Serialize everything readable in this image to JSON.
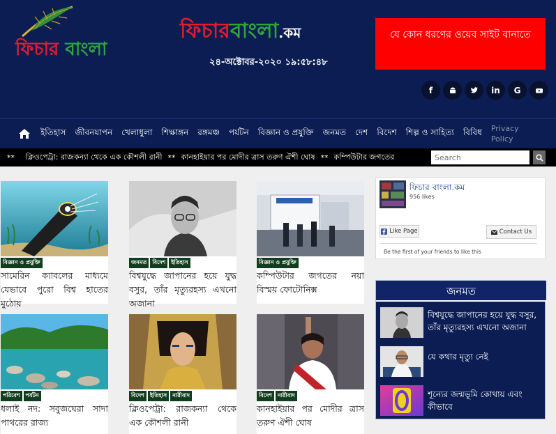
{
  "site": {
    "logo_left": {
      "part1": "ফিচার ",
      "part2": "বাংলা"
    },
    "logo_center": {
      "part1": "ফিচার",
      "part2": "বাংলা",
      "part3": ".কম"
    },
    "datetime": "২৪-অক্টোবর-২০২০ ১৯:৫৮:৪৮",
    "ad_text": "যে কোন ধরণের ওয়েব সাইট বানাতে"
  },
  "social": [
    {
      "icon": "facebook-icon",
      "glyph": "f"
    },
    {
      "icon": "android-icon",
      "glyph": ""
    },
    {
      "icon": "twitter-icon",
      "glyph": ""
    },
    {
      "icon": "linkedin-icon",
      "glyph": "in"
    },
    {
      "icon": "google-icon",
      "glyph": "G"
    },
    {
      "icon": "youtube-icon",
      "glyph": ""
    }
  ],
  "nav": {
    "items": [
      "ইতিহাস",
      "জীবনযাপন",
      "খেলাধুলা",
      "শিক্ষাঙ্গন",
      "রঙ্গমঞ্চ",
      "পর্যটন",
      "বিজ্ঞান ও প্রযুক্তি",
      "জনমত",
      "দেশ",
      "বিদেশ",
      "শিল্প ও সাহিত্য",
      "বিবিধ"
    ],
    "privacy": "Privacy Policy"
  },
  "ticker": {
    "items": [
      "ক্লিওপেট্রা: রাজকন্যা থেকে এক কৌশলী রানী",
      "কানহাইয়ার পর মোদীর ত্রাস তরুণ ঐশী ঘোষ",
      "কম্পিউটার জগতের"
    ],
    "separator": "**"
  },
  "search": {
    "placeholder": "Search"
  },
  "articles": [
    {
      "tags": [
        "বিজ্ঞান ও প্রযুক্তি"
      ],
      "title": "সামেরিন ক্যাবলের মাধ্যমে যেভাবে পুরো বিশ্ব হাতের মুঠোয়"
    },
    {
      "tags": [
        "জনমত",
        "বিদেশ",
        "ইতিহাস"
      ],
      "title": "বিশ্বযুদ্ধে জাপানের হয়ে যুদ্ধ বসুর, তাঁর মৃত্যুরহস্য এখনো অজানা"
    },
    {
      "tags": [
        "বিজ্ঞান ও প্রযুক্তি"
      ],
      "title": "কম্পিউটার জগতের নয়া বিস্ময় ফোটোনিক্স"
    },
    {
      "tags": [
        "পরিবেশ",
        "পর্যটন"
      ],
      "title": "ধলাই নদ: সবুজঘেরা সাদা পাথরের রাজ্য"
    },
    {
      "tags": [
        "বিদেশ",
        "ইতিহাস",
        "নারীবাদ"
      ],
      "title": "ক্লিওপেট্রা: রাজকন্যা থেকে এক কৌশলী রানী"
    },
    {
      "tags": [
        "বিদেশ",
        "নারীবাদ"
      ],
      "title": "কানহাইয়ার পর মোদীর ত্রাস তরুণ ঐশী ঘোষ"
    }
  ],
  "fb": {
    "page_name": "ফিচার বাংলা.কম",
    "likes": "956 likes",
    "like_button": "Like Page",
    "contact_button": "Contact Us",
    "friends_text": "Be the first of your friends to like this"
  },
  "popular": {
    "heading": "জনমত",
    "items": [
      "বিশ্বযুদ্ধে জাপানের হয়ে যুদ্ধ বসুর, তাঁর মৃত্যুরহস্য এখনো অজানা",
      "যে কথার মৃত্যু নেই",
      "শূন্যের জন্মভূমি কোথায় এবং কীভাবে"
    ]
  },
  "colors": {
    "header_bg": "#0b1d52",
    "ad_red": "#ff0000",
    "tag_green": "#103d1d",
    "logo_red": "#e11d2c",
    "logo_green": "#2ca53a"
  }
}
